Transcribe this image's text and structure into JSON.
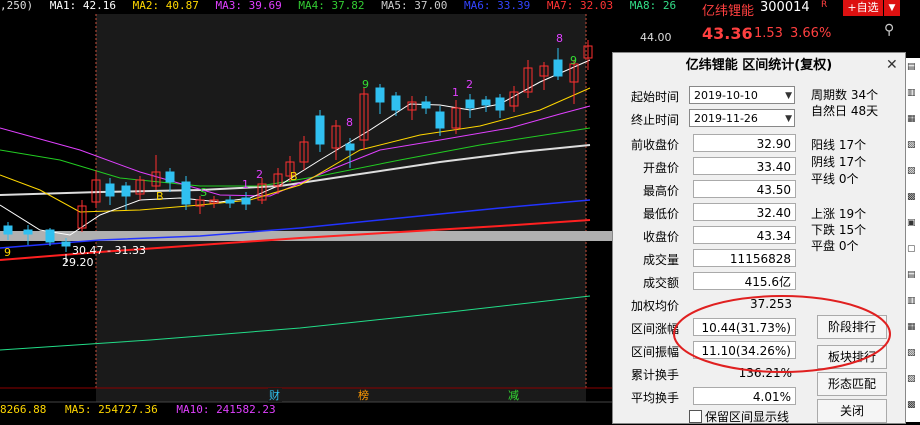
{
  "ma_bar": {
    "prefix": ",250)",
    "ma1": "MA1: 42.16",
    "ma2": "MA2: 40.87",
    "ma3": "MA3: 39.69",
    "ma4": "MA4: 37.82",
    "ma5": "MA5: 37.00",
    "ma6": "MA6: 33.39",
    "ma7": "MA7: 32.03",
    "ma8": "MA8: 26",
    "colors": {
      "prefix": "#dddddd",
      "ma1": "#ffffff",
      "ma2": "#ffd700",
      "ma3": "#e040ff",
      "ma4": "#33cc33",
      "ma5": "#cccccc",
      "ma6": "#3344ff",
      "ma7": "#ff3333",
      "ma8": "#33dd88"
    }
  },
  "stock": {
    "name": "亿纬锂能",
    "code": "300014",
    "badge": "R",
    "add_label": "+自选",
    "price": "43.36",
    "change": "1.53",
    "change_pct": "3.66%"
  },
  "axis": {
    "price_tick": "44.00"
  },
  "chart_annotations": {
    "low_label": "30.47 - 31.33",
    "low_point": "29.20",
    "markers": [
      "9",
      "B",
      "S",
      "1",
      "2",
      "B",
      "8",
      "9",
      "1",
      "2",
      "8",
      "9"
    ],
    "bottom_labels": [
      "财",
      "榜",
      "减"
    ]
  },
  "volume_bar": {
    "v0": "8266.88",
    "ma5": "MA5: 254727.36",
    "ma10": "MA10: 241582.23"
  },
  "dialog": {
    "title": "亿纬锂能 区间统计(复权)",
    "start_label": "起始时间",
    "start_value": "2019-10-10",
    "end_label": "终止时间",
    "end_value": "2019-11-26",
    "rows": [
      {
        "label": "前收盘价",
        "value": "32.90"
      },
      {
        "label": "开盘价",
        "value": "33.40"
      },
      {
        "label": "最高价",
        "value": "43.50"
      },
      {
        "label": "最低价",
        "value": "32.40"
      },
      {
        "label": "收盘价",
        "value": "43.34"
      },
      {
        "label": "成交量",
        "value": "11156828"
      },
      {
        "label": "成交额",
        "value": "415.6亿"
      },
      {
        "label": "加权均价",
        "value": "37.253"
      },
      {
        "label": "区间涨幅",
        "value": "10.44(31.73%)"
      },
      {
        "label": "区间振幅",
        "value": "11.10(34.26%)"
      },
      {
        "label": "累计换手",
        "value": "136.21%"
      },
      {
        "label": "平均换手",
        "value": "4.01%"
      }
    ],
    "stats": {
      "period": "周期数 34个",
      "natural_days": "自然日 48天",
      "yang": "阳线 17个",
      "yin": "阴线 17个",
      "flat_line": "平线 0个",
      "up": "上涨 19个",
      "down": "下跌 15个",
      "flat": "平盘 0个"
    },
    "buttons": {
      "stage_rank": "阶段排行",
      "sector_rank": "板块排行",
      "pattern_match": "形态匹配",
      "close": "关闭"
    },
    "checkbox_label": "保留区间显示线"
  }
}
